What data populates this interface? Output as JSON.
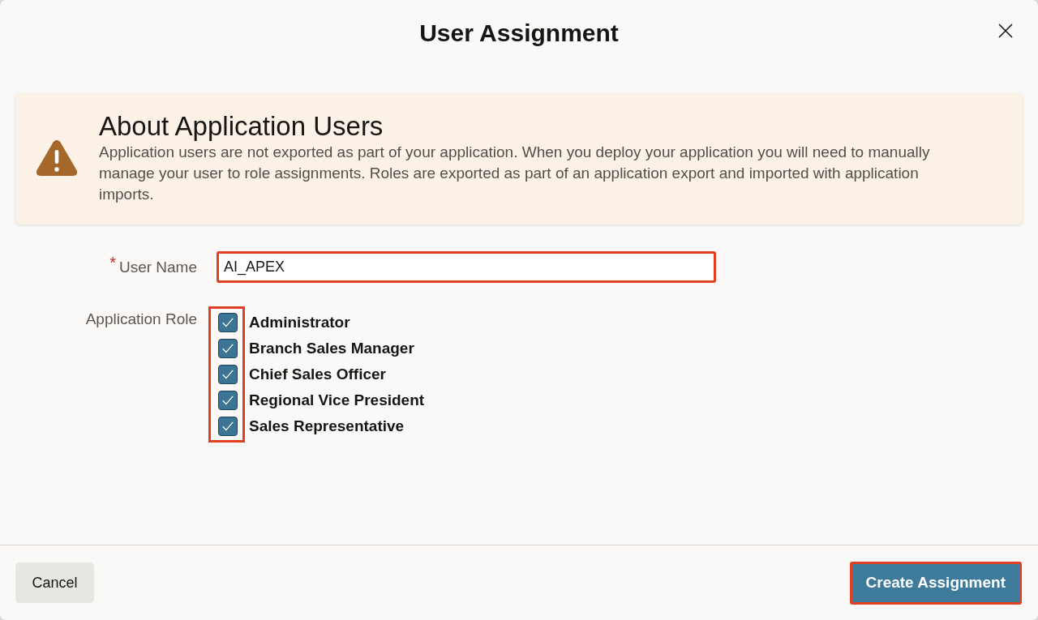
{
  "dialog": {
    "title": "User Assignment"
  },
  "alert": {
    "kind": "warning",
    "title": "About Application Users",
    "body": "Application users are not exported as part of your application. When you deploy your application you will need to manually manage your user to role assignments. Roles are exported as part of an application export and imported with application imports."
  },
  "form": {
    "user_name": {
      "label": "User Name",
      "required_mark": "*",
      "value": "AI_APEX",
      "highlighted": true
    },
    "application_role": {
      "label": "Application Role",
      "highlighted": true,
      "options": [
        {
          "label": "Administrator",
          "checked": true
        },
        {
          "label": "Branch Sales Manager",
          "checked": true
        },
        {
          "label": "Chief Sales Officer",
          "checked": true
        },
        {
          "label": "Regional Vice President",
          "checked": true
        },
        {
          "label": "Sales Representative",
          "checked": true
        }
      ]
    }
  },
  "footer": {
    "buttons": [
      {
        "label": "Cancel",
        "kind": "secondary",
        "highlighted": false
      },
      {
        "label": "Create Assignment",
        "kind": "primary",
        "highlighted": true
      }
    ]
  }
}
